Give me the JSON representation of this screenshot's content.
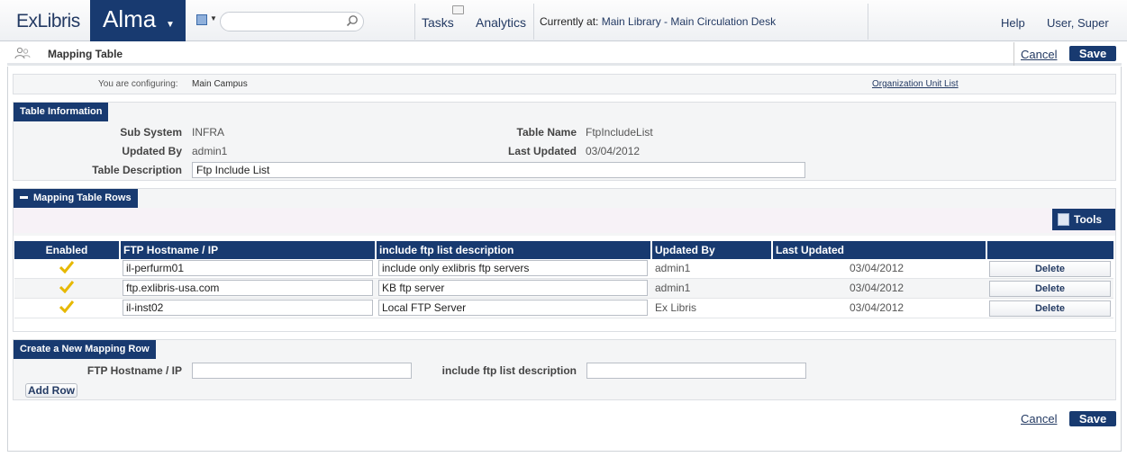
{
  "header": {
    "brand": "ExLibris",
    "product": "Alma",
    "search_placeholder": "",
    "tasks": "Tasks",
    "analytics": "Analytics",
    "currently_at_label": "Currently at:",
    "currently_at_value": "Main Library - Main Circulation Desk",
    "help": "Help",
    "user": "User, Super"
  },
  "page": {
    "title": "Mapping Table",
    "cancel": "Cancel",
    "save": "Save"
  },
  "config": {
    "label": "You are configuring:",
    "value": "Main Campus",
    "org_link": "Organization Unit List"
  },
  "table_info": {
    "heading": "Table Information",
    "sub_system_label": "Sub System",
    "sub_system": "INFRA",
    "table_name_label": "Table Name",
    "table_name": "FtpIncludeList",
    "updated_by_label": "Updated By",
    "updated_by": "admin1",
    "last_updated_label": "Last Updated",
    "last_updated": "03/04/2012",
    "description_label": "Table Description",
    "description": "Ftp Include List"
  },
  "mapping_rows": {
    "heading": "Mapping Table Rows",
    "tools": "Tools",
    "columns": [
      "Enabled",
      "FTP Hostname / IP",
      "include ftp list description",
      "Updated By",
      "Last Updated",
      ""
    ],
    "delete_label": "Delete",
    "rows": [
      {
        "enabled": true,
        "hostname": "il-perfurm01",
        "description": "include only exlibris ftp servers",
        "updated_by": "admin1",
        "last_updated": "03/04/2012"
      },
      {
        "enabled": true,
        "hostname": "ftp.exlibris-usa.com",
        "description": "KB ftp server",
        "updated_by": "admin1",
        "last_updated": "03/04/2012"
      },
      {
        "enabled": true,
        "hostname": "il-inst02",
        "description": "Local FTP Server",
        "updated_by": "Ex Libris",
        "last_updated": "03/04/2012"
      }
    ]
  },
  "new_row": {
    "heading": "Create a New Mapping Row",
    "hostname_label": "FTP Hostname / IP",
    "description_label": "include ftp list description",
    "hostname_value": "",
    "description_value": "",
    "add_button": "Add Row"
  },
  "footer": {
    "cancel": "Cancel",
    "save": "Save"
  },
  "colors": {
    "brand_navy": "#183a70",
    "link": "#233a63"
  }
}
